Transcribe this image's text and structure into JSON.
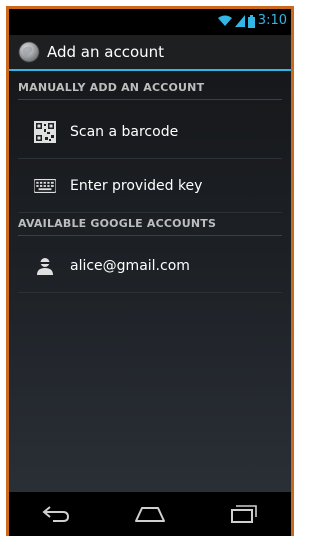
{
  "status_bar": {
    "time": "3:10",
    "icons": [
      "wifi-icon",
      "signal-icon",
      "battery-icon"
    ],
    "accent_color": "#33b5e5"
  },
  "action_bar": {
    "title": "Add an account",
    "icon": "app-globe-icon"
  },
  "sections": {
    "manual": {
      "header": "MANUALLY ADD AN ACCOUNT",
      "items": [
        {
          "label": "Scan a barcode",
          "icon": "qr-code-icon"
        },
        {
          "label": "Enter provided key",
          "icon": "keyboard-icon"
        }
      ]
    },
    "google": {
      "header": "AVAILABLE GOOGLE ACCOUNTS",
      "items": [
        {
          "label": "alice@gmail.com",
          "icon": "person-icon"
        }
      ]
    }
  },
  "nav_bar": {
    "buttons": [
      "back-icon",
      "home-icon",
      "recents-icon"
    ]
  }
}
